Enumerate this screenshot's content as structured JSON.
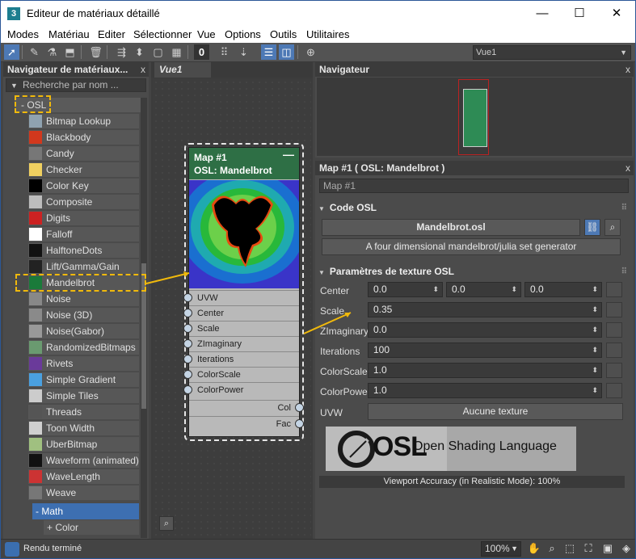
{
  "window": {
    "title": "Editeur de matériaux détaillé",
    "app_icon": "3",
    "min": "—",
    "max": "☐",
    "close": "✕"
  },
  "menu": [
    "Modes",
    "Matériau",
    "Editer",
    "Sélectionner",
    "Vue",
    "Options",
    "Outils",
    "Utilitaires"
  ],
  "toolbar": {
    "view_dropdown": "Vue1"
  },
  "browser": {
    "title": "Navigateur de matériaux...",
    "search_placeholder": "Recherche par nom ...",
    "osl_group": "- OSL",
    "items": [
      {
        "label": "Bitmap Lookup",
        "swatch": "#8fa2b0"
      },
      {
        "label": "Blackbody",
        "swatch": "#d2381d"
      },
      {
        "label": "Candy",
        "swatch": "#777777"
      },
      {
        "label": "Checker",
        "swatch": "#f0d060"
      },
      {
        "label": "Color Key",
        "swatch": "#000000"
      },
      {
        "label": "Composite",
        "swatch": "#bdbdbd"
      },
      {
        "label": "Digits",
        "swatch": "#cc2222"
      },
      {
        "label": "Falloff",
        "swatch": "#ffffff"
      },
      {
        "label": "HalftoneDots",
        "swatch": "#111111"
      },
      {
        "label": "Lift/Gamma/Gain",
        "swatch": "#222222"
      },
      {
        "label": "Mandelbrot",
        "swatch": "#1a7a3a"
      },
      {
        "label": "Noise",
        "swatch": "#888888"
      },
      {
        "label": "Noise (3D)",
        "swatch": "#8a8a8a"
      },
      {
        "label": "Noise(Gabor)",
        "swatch": "#999999"
      },
      {
        "label": "RandomizedBitmaps",
        "swatch": "#6a9a70"
      },
      {
        "label": "Rivets",
        "swatch": "#6a3a9a"
      },
      {
        "label": "Simple Gradient",
        "swatch": "#4aa0e0"
      },
      {
        "label": "Simple Tiles",
        "swatch": "#cccccc"
      },
      {
        "label": "Threads",
        "swatch": "#555555"
      },
      {
        "label": "Toon Width",
        "swatch": "#d0d0d0"
      },
      {
        "label": "UberBitmap",
        "swatch": "#a0c080"
      },
      {
        "label": "Waveform (animated)",
        "swatch": "#111111"
      },
      {
        "label": "WaveLength",
        "swatch": "#cc3333"
      },
      {
        "label": "Weave",
        "swatch": "#777777"
      }
    ],
    "math_group": "- Math",
    "color_group": "+ Color"
  },
  "view": {
    "tab": "Vue1"
  },
  "node": {
    "title": "Map #1",
    "subtitle": "OSL: Mandelbrot",
    "minimize": "—",
    "inputs": [
      "UVW",
      "Center",
      "Scale",
      "ZImaginary",
      "Iterations",
      "ColorScale",
      "ColorPower"
    ],
    "outputs": [
      "Col",
      "Fac"
    ]
  },
  "navigator": {
    "title": "Navigateur",
    "close": "x"
  },
  "params": {
    "title": "Map #1   ( OSL: Mandelbrot )",
    "close": "x",
    "name_field": "Map #1",
    "code_section": "Code OSL",
    "code_file": "Mandelbrot.osl",
    "description": "A four dimensional mandelbrot/julia set generator",
    "tex_section": "Paramètres de texture OSL",
    "center_label": "Center",
    "center": [
      "0.0",
      "0.0",
      "0.0"
    ],
    "rows": [
      {
        "label": "Scale",
        "value": "0.35"
      },
      {
        "label": "ZImaginary",
        "value": "0.0"
      },
      {
        "label": "Iterations",
        "value": "100"
      },
      {
        "label": "ColorScale",
        "value": "1.0"
      },
      {
        "label": "ColorPower",
        "value": "1.0"
      }
    ],
    "uvw_label": "UVW",
    "uvw_button": "Aucune texture",
    "banner_text": "Open Shading Language",
    "banner_logo": "OSL",
    "viewport_accuracy": "Viewport Accuracy (in Realistic Mode): 100%"
  },
  "status": {
    "text": "Rendu terminé",
    "zoom": "100%"
  }
}
